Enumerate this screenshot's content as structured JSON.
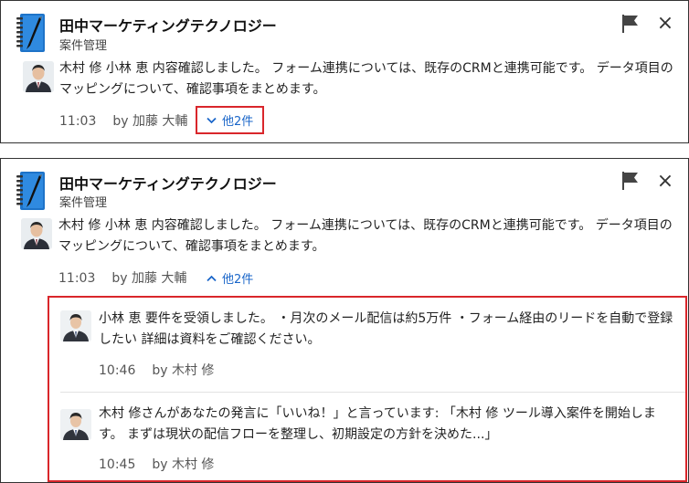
{
  "notification_collapsed": {
    "app_name": "田中マーケティングテクノロジー",
    "app_category": "案件管理",
    "message": "木村 修 小林 恵 内容確認しました。 フォーム連携については、既存のCRMと連携可能です。 データ項目のマッピングについて、確認事項をまとめます。",
    "time": "11:03",
    "by": "by 加藤 大輔",
    "toggle_label": "他2件",
    "toggle_icon": "chevron-down-icon"
  },
  "notification_expanded": {
    "app_name": "田中マーケティングテクノロジー",
    "app_category": "案件管理",
    "message": "木村 修 小林 恵 内容確認しました。 フォーム連携については、既存のCRMと連携可能です。 データ項目のマッピングについて、確認事項をまとめます。",
    "time": "11:03",
    "by": "by 加藤 大輔",
    "toggle_label": "他2件",
    "toggle_icon": "chevron-up-icon",
    "replies": [
      {
        "message": "小林 恵 要件を受領しました。 ・月次のメール配信は約5万件 ・フォーム経由のリードを自動で登録したい 詳細は資料をご確認ください。",
        "time": "10:46",
        "by": "by 木村 修"
      },
      {
        "message": "木村 修さんがあなたの発言に「いいね！」と言っています: 「木村 修 ツール導入案件を開始します。 まずは現状の配信フローを整理し、初期設定の方針を決めた...」",
        "time": "10:45",
        "by": "by 木村 修"
      }
    ]
  },
  "colors": {
    "highlight_border": "#d9262b",
    "link": "#1a66c9",
    "app_icon_blue": "#1e73c8"
  }
}
